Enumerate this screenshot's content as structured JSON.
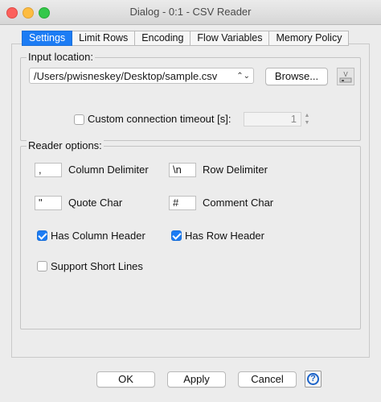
{
  "window": {
    "title": "Dialog - 0:1 - CSV Reader"
  },
  "tabs": [
    {
      "label": "Settings",
      "active": true
    },
    {
      "label": "Limit Rows",
      "active": false
    },
    {
      "label": "Encoding",
      "active": false
    },
    {
      "label": "Flow Variables",
      "active": false
    },
    {
      "label": "Memory Policy",
      "active": false
    }
  ],
  "input_location": {
    "label": "Input location:",
    "path": "/Users/pwisneskey/Desktop/sample.csv",
    "browse_label": "Browse...",
    "flow_variable_icon": "flow-variable-icon",
    "timeout_label": "Custom connection timeout [s]:",
    "timeout_checked": false,
    "timeout_value": "1"
  },
  "reader_options": {
    "label": "Reader options:",
    "column_delimiter": {
      "label": "Column Delimiter",
      "value": ","
    },
    "row_delimiter": {
      "label": "Row Delimiter",
      "value": "\\n"
    },
    "quote_char": {
      "label": "Quote Char",
      "value": "\""
    },
    "comment_char": {
      "label": "Comment Char",
      "value": "#"
    },
    "has_column_header": {
      "label": "Has Column Header",
      "checked": true
    },
    "has_row_header": {
      "label": "Has Row Header",
      "checked": true
    },
    "support_short_lines": {
      "label": "Support Short Lines",
      "checked": false
    }
  },
  "buttons": {
    "ok": "OK",
    "apply": "Apply",
    "cancel": "Cancel",
    "help_icon": "help-icon"
  },
  "colors": {
    "accent": "#1c7cf4",
    "close": "#fc605c",
    "minimize": "#fdbc40",
    "zoom": "#34c84a"
  }
}
